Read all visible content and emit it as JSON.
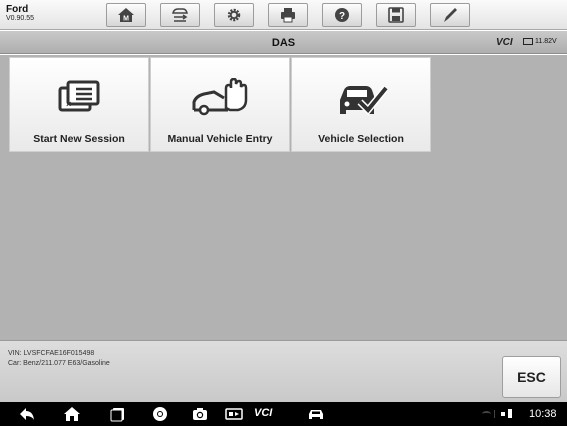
{
  "app": {
    "name": "Ford",
    "version": "V0.90.55"
  },
  "toolbar": {
    "buttons": [
      {
        "name": "home-button",
        "icon": "m-home-icon"
      },
      {
        "name": "vehicle-swap-button",
        "icon": "car-swap-icon"
      },
      {
        "name": "settings-button",
        "icon": "gear-icon"
      },
      {
        "name": "print-button",
        "icon": "printer-icon"
      },
      {
        "name": "help-button",
        "icon": "question-icon"
      },
      {
        "name": "save-button",
        "icon": "floppy-icon"
      },
      {
        "name": "edit-button",
        "icon": "pen-icon"
      }
    ]
  },
  "header": {
    "title": "DAS",
    "vci_label": "VCI",
    "voltage": "11.82V"
  },
  "tiles": [
    {
      "label": "Start New Session",
      "icon": "session-card-icon"
    },
    {
      "label": "Manual Vehicle Entry",
      "icon": "hand-car-icon"
    },
    {
      "label": "Vehicle Selection",
      "icon": "car-check-icon"
    }
  ],
  "info": {
    "vin": "VIN: LVSFCFAE16F015498",
    "car": "Car: Benz/211.077 E63/Gasoline",
    "esc_label": "ESC"
  },
  "navbar": {
    "vci_label": "VCI",
    "time": "10:38"
  },
  "colors": {
    "content_bg": "#b2b2b2",
    "navbar_bg": "#000000",
    "tile_bg": "#ffffff"
  }
}
